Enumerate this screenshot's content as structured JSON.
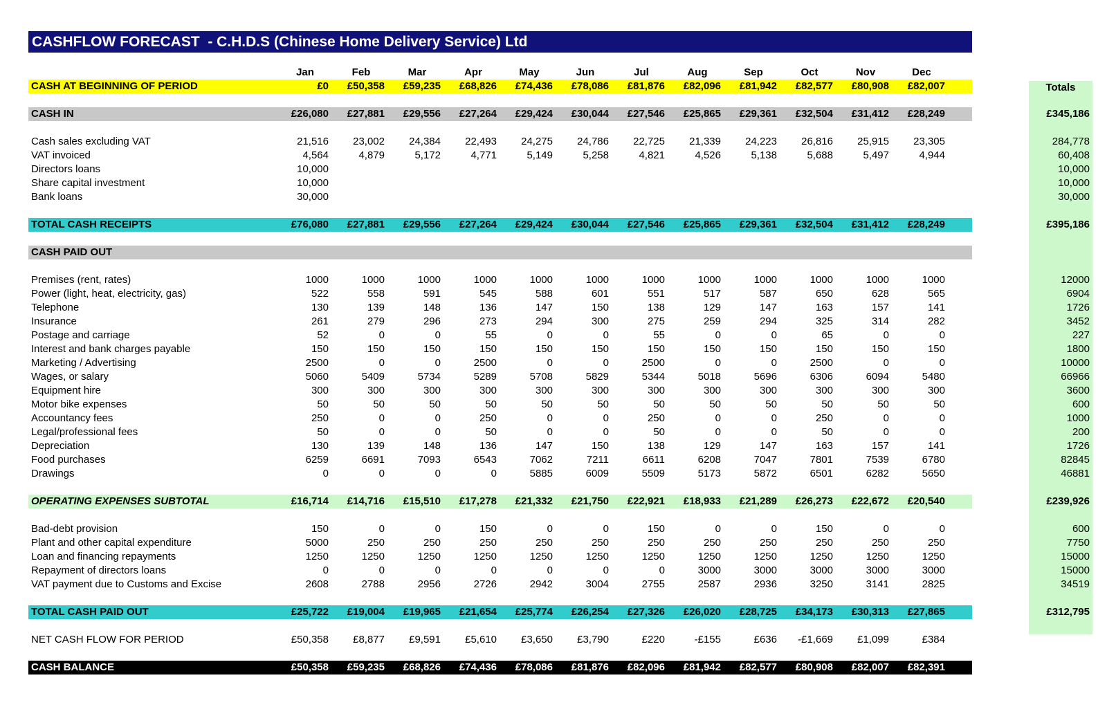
{
  "title": "CASHFLOW FORECAST  - C.H.D.S (Chinese Home Delivery Service) Ltd",
  "months": [
    "Jan",
    "Feb",
    "Mar",
    "Apr",
    "May",
    "Jun",
    "Jul",
    "Aug",
    "Sep",
    "Oct",
    "Nov",
    "Dec"
  ],
  "totals_header": "Totals",
  "rows": {
    "cash_begin": {
      "label": "CASH AT BEGINNING OF PERIOD",
      "values": [
        "£0",
        "£50,358",
        "£59,235",
        "£68,826",
        "£74,436",
        "£78,086",
        "£81,876",
        "£82,096",
        "£81,942",
        "£82,577",
        "£80,908",
        "£82,007"
      ],
      "total": ""
    },
    "cash_in": {
      "label": "CASH IN",
      "values": [
        "£26,080",
        "£27,881",
        "£29,556",
        "£27,264",
        "£29,424",
        "£30,044",
        "£27,546",
        "£25,865",
        "£29,361",
        "£32,504",
        "£31,412",
        "£28,249"
      ],
      "total": "£345,186"
    },
    "cash_sales": {
      "label": "Cash sales excluding VAT",
      "values": [
        "21,516",
        "23,002",
        "24,384",
        "22,493",
        "24,275",
        "24,786",
        "22,725",
        "21,339",
        "24,223",
        "26,816",
        "25,915",
        "23,305"
      ],
      "total": "284,778"
    },
    "vat_invoiced": {
      "label": "VAT invoiced",
      "values": [
        "4,564",
        "4,879",
        "5,172",
        "4,771",
        "5,149",
        "5,258",
        "4,821",
        "4,526",
        "5,138",
        "5,688",
        "5,497",
        "4,944"
      ],
      "total": "60,408"
    },
    "directors_loans": {
      "label": "Directors loans",
      "values": [
        "10,000",
        "",
        "",
        "",
        "",
        "",
        "",
        "",
        "",
        "",
        "",
        ""
      ],
      "total": "10,000"
    },
    "share_capital": {
      "label": "Share capital investment",
      "values": [
        "10,000",
        "",
        "",
        "",
        "",
        "",
        "",
        "",
        "",
        "",
        "",
        ""
      ],
      "total": "10,000"
    },
    "bank_loans": {
      "label": "Bank loans",
      "values": [
        "30,000",
        "",
        "",
        "",
        "",
        "",
        "",
        "",
        "",
        "",
        "",
        ""
      ],
      "total": "30,000"
    },
    "total_receipts": {
      "label": "TOTAL CASH RECEIPTS",
      "values": [
        "£76,080",
        "£27,881",
        "£29,556",
        "£27,264",
        "£29,424",
        "£30,044",
        "£27,546",
        "£25,865",
        "£29,361",
        "£32,504",
        "£31,412",
        "£28,249"
      ],
      "total": "£395,186"
    },
    "cash_paid_out": {
      "label": "CASH PAID OUT",
      "values": [
        "",
        "",
        "",
        "",
        "",
        "",
        "",
        "",
        "",
        "",
        "",
        ""
      ],
      "total": ""
    },
    "premises": {
      "label": "Premises (rent, rates)",
      "values": [
        "1000",
        "1000",
        "1000",
        "1000",
        "1000",
        "1000",
        "1000",
        "1000",
        "1000",
        "1000",
        "1000",
        "1000"
      ],
      "total": "12000"
    },
    "power": {
      "label": "Power (light, heat, electricity, gas)",
      "values": [
        "522",
        "558",
        "591",
        "545",
        "588",
        "601",
        "551",
        "517",
        "587",
        "650",
        "628",
        "565"
      ],
      "total": "6904"
    },
    "telephone": {
      "label": "Telephone",
      "values": [
        "130",
        "139",
        "148",
        "136",
        "147",
        "150",
        "138",
        "129",
        "147",
        "163",
        "157",
        "141"
      ],
      "total": "1726"
    },
    "insurance": {
      "label": "Insurance",
      "values": [
        "261",
        "279",
        "296",
        "273",
        "294",
        "300",
        "275",
        "259",
        "294",
        "325",
        "314",
        "282"
      ],
      "total": "3452"
    },
    "postage": {
      "label": "Postage and carriage",
      "values": [
        "52",
        "0",
        "0",
        "55",
        "0",
        "0",
        "55",
        "0",
        "0",
        "65",
        "0",
        "0"
      ],
      "total": "227"
    },
    "interest": {
      "label": "Interest and bank charges payable",
      "values": [
        "150",
        "150",
        "150",
        "150",
        "150",
        "150",
        "150",
        "150",
        "150",
        "150",
        "150",
        "150"
      ],
      "total": "1800"
    },
    "marketing": {
      "label": "Marketing / Advertising",
      "values": [
        "2500",
        "0",
        "0",
        "2500",
        "0",
        "0",
        "2500",
        "0",
        "0",
        "2500",
        "0",
        "0"
      ],
      "total": "10000"
    },
    "wages": {
      "label": "Wages, or salary",
      "values": [
        "5060",
        "5409",
        "5734",
        "5289",
        "5708",
        "5829",
        "5344",
        "5018",
        "5696",
        "6306",
        "6094",
        "5480"
      ],
      "total": "66966"
    },
    "equipment": {
      "label": "Equipment hire",
      "values": [
        "300",
        "300",
        "300",
        "300",
        "300",
        "300",
        "300",
        "300",
        "300",
        "300",
        "300",
        "300"
      ],
      "total": "3600"
    },
    "motorbike": {
      "label": "Motor bike expenses",
      "values": [
        "50",
        "50",
        "50",
        "50",
        "50",
        "50",
        "50",
        "50",
        "50",
        "50",
        "50",
        "50"
      ],
      "total": "600"
    },
    "accountancy": {
      "label": "Accountancy fees",
      "values": [
        "250",
        "0",
        "0",
        "250",
        "0",
        "0",
        "250",
        "0",
        "0",
        "250",
        "0",
        "0"
      ],
      "total": "1000"
    },
    "legal": {
      "label": "Legal/professional fees",
      "values": [
        "50",
        "0",
        "0",
        "50",
        "0",
        "0",
        "50",
        "0",
        "0",
        "50",
        "0",
        "0"
      ],
      "total": "200"
    },
    "depreciation": {
      "label": "Depreciation",
      "values": [
        "130",
        "139",
        "148",
        "136",
        "147",
        "150",
        "138",
        "129",
        "147",
        "163",
        "157",
        "141"
      ],
      "total": "1726"
    },
    "food": {
      "label": "Food purchases",
      "values": [
        "6259",
        "6691",
        "7093",
        "6543",
        "7062",
        "7211",
        "6611",
        "6208",
        "7047",
        "7801",
        "7539",
        "6780"
      ],
      "total": "82845"
    },
    "drawings": {
      "label": "Drawings",
      "values": [
        "0",
        "0",
        "0",
        "0",
        "5885",
        "6009",
        "5509",
        "5173",
        "5872",
        "6501",
        "6282",
        "5650"
      ],
      "total": "46881"
    },
    "opex_subtotal": {
      "label": "OPERATING EXPENSES SUBTOTAL",
      "values": [
        "£16,714",
        "£14,716",
        "£15,510",
        "£17,278",
        "£21,332",
        "£21,750",
        "£22,921",
        "£18,933",
        "£21,289",
        "£26,273",
        "£22,672",
        "£20,540"
      ],
      "total": "£239,926"
    },
    "bad_debt": {
      "label": "Bad-debt provision",
      "values": [
        "150",
        "0",
        "0",
        "150",
        "0",
        "0",
        "150",
        "0",
        "0",
        "150",
        "0",
        "0"
      ],
      "total": "600"
    },
    "plant": {
      "label": "Plant and other capital expenditure",
      "values": [
        "5000",
        "250",
        "250",
        "250",
        "250",
        "250",
        "250",
        "250",
        "250",
        "250",
        "250",
        "250"
      ],
      "total": "7750"
    },
    "loan_repay": {
      "label": "Loan and financing repayments",
      "values": [
        "1250",
        "1250",
        "1250",
        "1250",
        "1250",
        "1250",
        "1250",
        "1250",
        "1250",
        "1250",
        "1250",
        "1250"
      ],
      "total": "15000"
    },
    "director_repay": {
      "label": "Repayment of directors loans",
      "values": [
        "0",
        "0",
        "0",
        "0",
        "0",
        "0",
        "0",
        "3000",
        "3000",
        "3000",
        "3000",
        "3000"
      ],
      "total": "15000"
    },
    "vat_payment": {
      "label": "VAT payment due to Customs and Excise",
      "values": [
        "2608",
        "2788",
        "2956",
        "2726",
        "2942",
        "3004",
        "2755",
        "2587",
        "2936",
        "3250",
        "3141",
        "2825"
      ],
      "total": "34519"
    },
    "total_paid_out": {
      "label": "TOTAL CASH PAID OUT",
      "values": [
        "£25,722",
        "£19,004",
        "£19,965",
        "£21,654",
        "£25,774",
        "£26,254",
        "£27,326",
        "£26,020",
        "£28,725",
        "£34,173",
        "£30,313",
        "£27,865"
      ],
      "total": "£312,795"
    },
    "net_cash_flow": {
      "label": "NET CASH FLOW FOR PERIOD",
      "values": [
        "£50,358",
        "£8,877",
        "£9,591",
        "£5,610",
        "£3,650",
        "£3,790",
        "£220",
        "-£155",
        "£636",
        "-£1,669",
        "£1,099",
        "£384"
      ],
      "total": ""
    },
    "cash_balance": {
      "label": "CASH BALANCE",
      "values": [
        "£50,358",
        "£59,235",
        "£68,826",
        "£74,436",
        "£78,086",
        "£81,876",
        "£82,096",
        "£81,942",
        "£82,577",
        "£80,908",
        "£82,007",
        "£82,391"
      ],
      "total": ""
    }
  },
  "colors": {
    "banner": "#11117a",
    "yellow": "#ffff00",
    "grey": "#c8c8c8",
    "cyan": "#33cccc",
    "green": "#ccf8cc",
    "black": "#000000"
  }
}
